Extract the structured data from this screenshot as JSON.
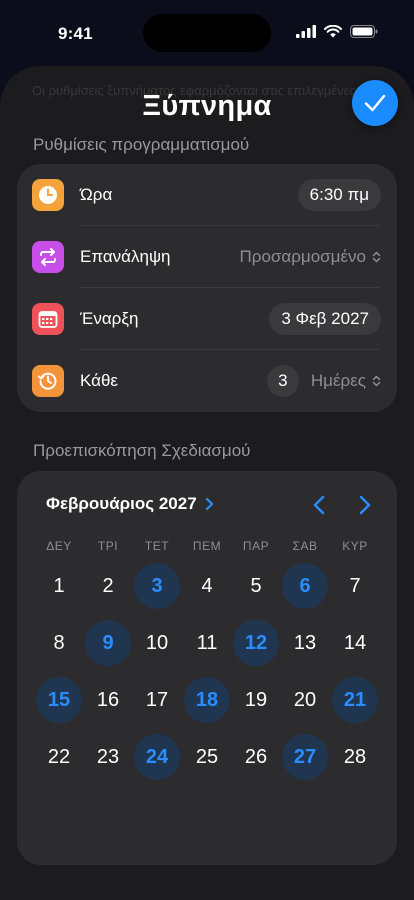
{
  "status_bar": {
    "time": "9:41"
  },
  "sheet": {
    "background_text": "Οι ρυθμίσεις ξυπνήματος εφαρμόζονται στις επιλεγμένες ημέρες για όλους τους συναγερμούς",
    "title": "Ξύπνημα"
  },
  "schedule": {
    "header": "Ρυθμίσεις προγραμματισμού",
    "time_label": "Ώρα",
    "time_value": "6:30 πμ",
    "repeat_label": "Επανάληψη",
    "repeat_value": "Προσαρμοσμένο",
    "start_label": "Έναρξη",
    "start_value": "3 Φεβ 2027",
    "every_label": "Κάθε",
    "every_count": "3",
    "every_unit": "Ημέρες"
  },
  "preview": {
    "header": "Προεπισκόπηση Σχεδιασμού",
    "month": "Φεβρουάριος 2027",
    "weekdays": [
      "ΔΕΥ",
      "ΤΡΙ",
      "ΤΕΤ",
      "ΠΕΜ",
      "ΠΑΡ",
      "ΣΑΒ",
      "ΚΥΡ"
    ],
    "days": [
      "1",
      "2",
      "3",
      "4",
      "5",
      "6",
      "7",
      "8",
      "9",
      "10",
      "11",
      "12",
      "13",
      "14",
      "15",
      "16",
      "17",
      "18",
      "19",
      "20",
      "21",
      "22",
      "23",
      "24",
      "25",
      "26",
      "27",
      "28"
    ],
    "selected_days": [
      3,
      6,
      9,
      12,
      15,
      18,
      21,
      24,
      27
    ]
  },
  "colors": {
    "accent": "#1a8cff",
    "time_icon": "#f3a33a",
    "repeat_icon": "#c84ee8",
    "start_icon": "#f0525a",
    "every_icon": "#f3943a"
  }
}
